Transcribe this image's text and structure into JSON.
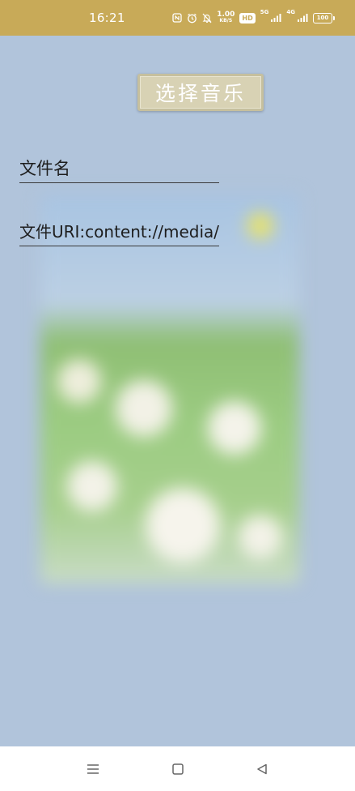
{
  "status_bar": {
    "time": "16:21",
    "network_speed": "1.00",
    "network_speed_unit": "KB/S",
    "hd_badge": "HD",
    "signal1_label": "5G",
    "signal2_label": "4G",
    "battery_level": "100",
    "icons": [
      "nfc-icon",
      "alarm-icon",
      "mute-bell-icon",
      "signal-icon",
      "signal-icon",
      "battery-icon"
    ]
  },
  "main": {
    "select_music_label": "选择音乐",
    "file_name_label": "文件名",
    "file_uri_label": "文件URI:content://media/"
  },
  "nav": {
    "menu_icon": "menu-icon",
    "home_icon": "home-icon",
    "back_icon": "back-icon"
  },
  "colors": {
    "status_bar": "#c8aa58",
    "background": "#b1c4db",
    "button": "#d8d2b4",
    "nav_bar": "#ffffff"
  }
}
